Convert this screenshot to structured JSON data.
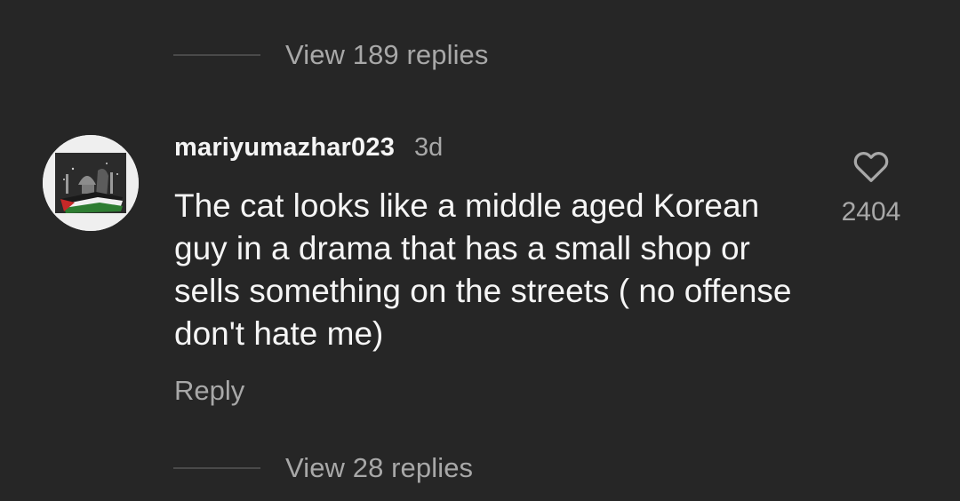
{
  "thread": {
    "view_replies_top": "View 189 replies",
    "view_replies_bottom": "View 28 replies"
  },
  "comment": {
    "username": "mariyumazhar023",
    "time": "3d",
    "text": "The cat looks like a middle aged Korean guy in a drama that has a small shop or sells something on the streets ( no offense don't hate me)",
    "reply_label": "Reply",
    "like_count": "2404",
    "like_icon": "heart-outline-icon",
    "avatar_icon": "profile-picture"
  },
  "colors": {
    "background": "#262626",
    "primary_text": "#f5f5f5",
    "secondary_text": "#a8a8a8",
    "divider": "#4a4a4a"
  }
}
